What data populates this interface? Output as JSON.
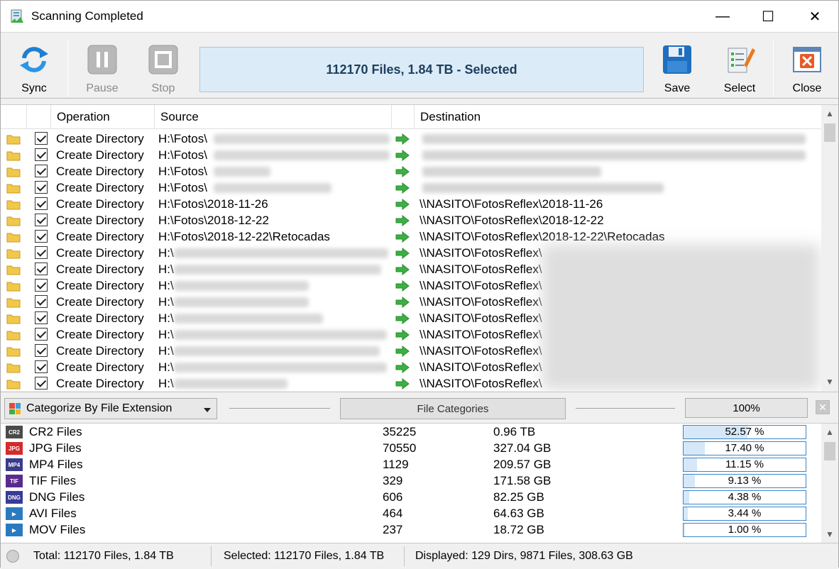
{
  "window": {
    "title": "Scanning Completed",
    "minimize_glyph": "—",
    "maximize_glyph": "☐",
    "close_glyph": "✕"
  },
  "toolbar": {
    "sync_label": "Sync",
    "pause_label": "Pause",
    "stop_label": "Stop",
    "status_text": "112170 Files, 1.84 TB - Selected",
    "save_label": "Save",
    "select_label": "Select",
    "close_label": "Close"
  },
  "grid": {
    "columns": {
      "operation": "Operation",
      "source": "Source",
      "destination": "Destination"
    },
    "rows": [
      {
        "operation": "Create Directory",
        "source": "H:\\Fotos\\",
        "destination": "",
        "checked": true
      },
      {
        "operation": "Create Directory",
        "source": "H:\\Fotos\\",
        "destination": "",
        "checked": true
      },
      {
        "operation": "Create Directory",
        "source": "H:\\Fotos\\",
        "destination": "",
        "checked": true
      },
      {
        "operation": "Create Directory",
        "source": "H:\\Fotos\\",
        "destination": "",
        "checked": true
      },
      {
        "operation": "Create Directory",
        "source": "H:\\Fotos\\2018-11-26",
        "destination": "\\\\NASITO\\FotosReflex\\2018-11-26",
        "checked": true
      },
      {
        "operation": "Create Directory",
        "source": "H:\\Fotos\\2018-12-22",
        "destination": "\\\\NASITO\\FotosReflex\\2018-12-22",
        "checked": true
      },
      {
        "operation": "Create Directory",
        "source": "H:\\Fotos\\2018-12-22\\Retocadas",
        "destination": "\\\\NASITO\\FotosReflex\\2018-12-22\\Retocadas",
        "checked": true
      },
      {
        "operation": "Create Directory",
        "source": "H:\\",
        "destination": "\\\\NASITO\\FotosReflex\\",
        "checked": true
      },
      {
        "operation": "Create Directory",
        "source": "H:\\",
        "destination": "\\\\NASITO\\FotosReflex\\",
        "checked": true
      },
      {
        "operation": "Create Directory",
        "source": "H:\\",
        "destination": "\\\\NASITO\\FotosReflex\\",
        "checked": true
      },
      {
        "operation": "Create Directory",
        "source": "H:\\",
        "destination": "\\\\NASITO\\FotosReflex\\",
        "checked": true
      },
      {
        "operation": "Create Directory",
        "source": "H:\\",
        "destination": "\\\\NASITO\\FotosReflex\\",
        "checked": true
      },
      {
        "operation": "Create Directory",
        "source": "H:\\",
        "destination": "\\\\NASITO\\FotosReflex\\",
        "checked": true
      },
      {
        "operation": "Create Directory",
        "source": "H:\\",
        "destination": "\\\\NASITO\\FotosReflex\\",
        "checked": true
      },
      {
        "operation": "Create Directory",
        "source": "H:\\",
        "destination": "\\\\NASITO\\FotosReflex\\",
        "checked": true
      },
      {
        "operation": "Create Directory",
        "source": "H:\\",
        "destination": "\\\\NASITO\\FotosReflex\\",
        "checked": true
      }
    ]
  },
  "midbar": {
    "categorize_value": "Categorize By File Extension",
    "file_categories_label": "File Categories",
    "percent_label": "100%",
    "close_glyph": "✕"
  },
  "categories": [
    {
      "name": "CR2 Files",
      "badge": "CR2",
      "count": "35225",
      "size": "0.96 TB",
      "percent_text": "52.57 %",
      "percent": 52.57,
      "color": "#4a4a4a"
    },
    {
      "name": "JPG Files",
      "badge": "JPG",
      "count": "70550",
      "size": "327.04 GB",
      "percent_text": "17.40 %",
      "percent": 17.4,
      "color": "#d62a2a"
    },
    {
      "name": "MP4 Files",
      "badge": "MP4",
      "count": "1129",
      "size": "209.57 GB",
      "percent_text": "11.15 %",
      "percent": 11.15,
      "color": "#3b3b8c"
    },
    {
      "name": "TIF Files",
      "badge": "TIF",
      "count": "329",
      "size": "171.58 GB",
      "percent_text": "9.13 %",
      "percent": 9.13,
      "color": "#5a2a8c"
    },
    {
      "name": "DNG Files",
      "badge": "DNG",
      "count": "606",
      "size": "82.25 GB",
      "percent_text": "4.38 %",
      "percent": 4.38,
      "color": "#3a3a9a"
    },
    {
      "name": "AVI Files",
      "badge": "▶",
      "count": "464",
      "size": "64.63 GB",
      "percent_text": "3.44 %",
      "percent": 3.44,
      "color": "#2a7ac0"
    },
    {
      "name": "MOV Files",
      "badge": "▶",
      "count": "237",
      "size": "18.72 GB",
      "percent_text": "1.00 %",
      "percent": 1.0,
      "color": "#2a7ac0"
    }
  ],
  "statusbar": {
    "total": "Total: 112170 Files, 1.84 TB",
    "selected": "Selected: 112170 Files, 1.84 TB",
    "displayed": "Displayed: 129 Dirs, 9871 Files, 308.63 GB"
  },
  "colors": {
    "status_box_bg": "#dbecf8",
    "status_box_text": "#1d3e5e",
    "progress_border": "#3a86c6",
    "progress_fill": "#d6e8f7",
    "arrow_green": "#3cb043",
    "folder_yellow": "#f2c84b"
  }
}
